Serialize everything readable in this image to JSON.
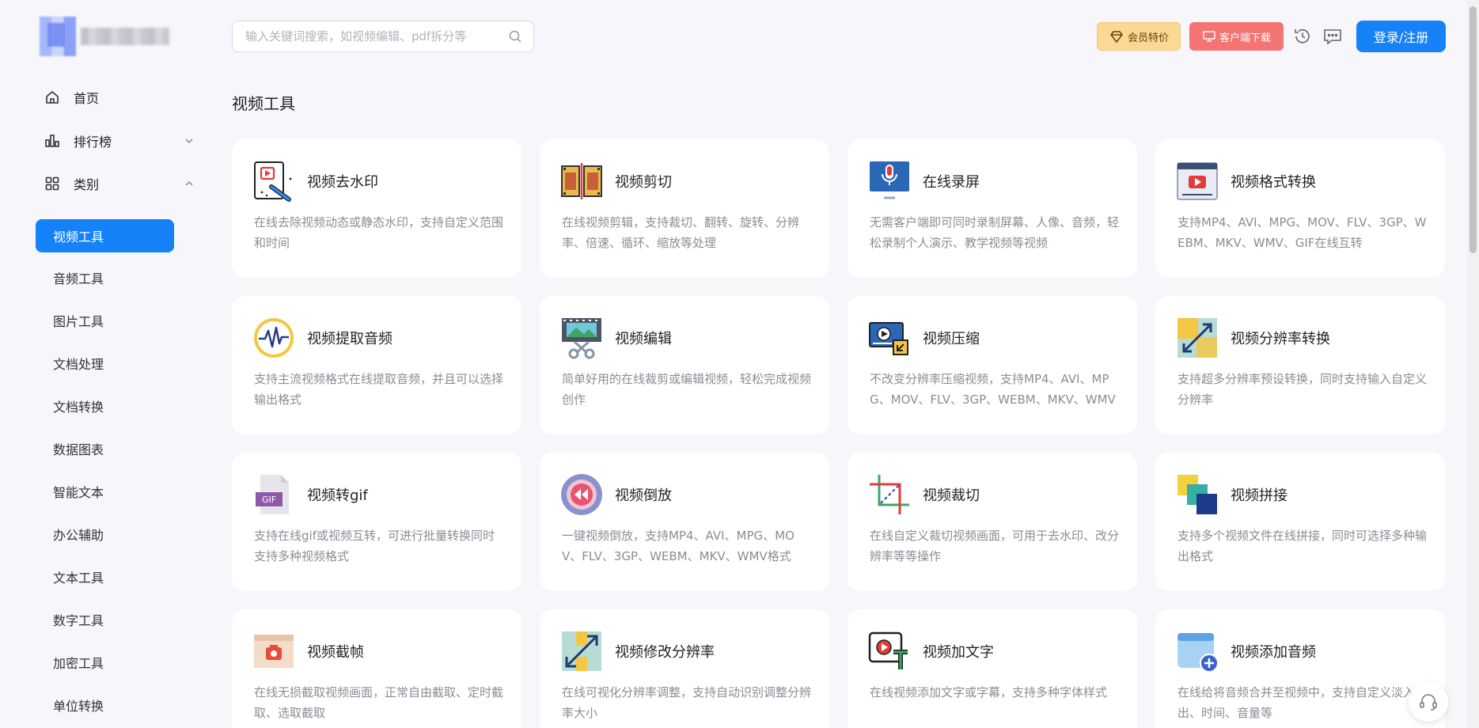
{
  "brand": {
    "logo_alt": "logo"
  },
  "sidebar": {
    "nav": [
      {
        "label": "首页",
        "icon": "home-icon"
      },
      {
        "label": "排行榜",
        "icon": "bar-chart-icon",
        "chevron": "chevron-down-icon"
      },
      {
        "label": "类别",
        "icon": "grid-icon",
        "chevron": "chevron-up-icon"
      }
    ],
    "categories": [
      {
        "label": "视频工具",
        "active": true
      },
      {
        "label": "音频工具"
      },
      {
        "label": "图片工具"
      },
      {
        "label": "文档处理"
      },
      {
        "label": "文档转换"
      },
      {
        "label": "数据图表"
      },
      {
        "label": "智能文本"
      },
      {
        "label": "办公辅助"
      },
      {
        "label": "文本工具"
      },
      {
        "label": "数字工具"
      },
      {
        "label": "加密工具"
      },
      {
        "label": "单位转换"
      }
    ]
  },
  "header": {
    "search_placeholder": "输入关键词搜索，如视频编辑、pdf拆分等",
    "vip_label": "会员特价",
    "client_label": "客户端下载",
    "login_label": "登录/注册"
  },
  "main": {
    "section_title": "视频工具",
    "cards": [
      {
        "title": "视频去水印",
        "desc": "在线去除视频动态或静态水印，支持自定义范围和时间",
        "icon": "watermark-remove-icon"
      },
      {
        "title": "视频剪切",
        "desc": "在线视频剪辑，支持裁切、翻转、旋转、分辨率、倍速、循环、缩放等处理",
        "icon": "film-cut-icon"
      },
      {
        "title": "在线录屏",
        "desc": "无需客户端即可同时录制屏幕、人像、音频，轻松录制个人演示、教学视频等视频",
        "icon": "screen-record-icon"
      },
      {
        "title": "视频格式转换",
        "desc": "支持MP4、AVI、MPG、MOV、FLV、3GP、WEBM、MKV、WMV、GIF在线互转",
        "icon": "video-format-icon"
      },
      {
        "title": "视频提取音频",
        "desc": "支持主流视频格式在线提取音频，并且可以选择输出格式",
        "icon": "audio-wave-icon"
      },
      {
        "title": "视频编辑",
        "desc": "简单好用的在线裁剪或编辑视频，轻松完成视频创作",
        "icon": "video-edit-icon"
      },
      {
        "title": "视频压缩",
        "desc": "不改变分辨率压缩视频，支持MP4、AVI、MPG、MOV、FLV、3GP、WEBM、MKV、WMV",
        "icon": "video-compress-icon"
      },
      {
        "title": "视频分辨率转换",
        "desc": "支持超多分辨率预设转换，同时支持输入自定义分辨率",
        "icon": "resolution-icon"
      },
      {
        "title": "视频转gif",
        "desc": "支持在线gif或视频互转，可进行批量转换同时支持多种视频格式",
        "icon": "gif-file-icon"
      },
      {
        "title": "视频倒放",
        "desc": "一键视频倒放，支持MP4、AVI、MPG、MOV、FLV、3GP、WEBM、MKV、WMV格式",
        "icon": "rewind-icon"
      },
      {
        "title": "视频裁切",
        "desc": "在线自定义裁切视频画面，可用于去水印、改分辨率等等操作",
        "icon": "crop-icon"
      },
      {
        "title": "视频拼接",
        "desc": "支持多个视频文件在线拼接，同时可选择多种输出格式",
        "icon": "merge-icon"
      },
      {
        "title": "视频截帧",
        "desc": "在线无损截取视频画面，正常自由截取、定时截取、选取截取",
        "icon": "frame-capture-icon"
      },
      {
        "title": "视频修改分辨率",
        "desc": "在线可视化分辨率调整，支持自动识别调整分辨率大小",
        "icon": "resize-icon"
      },
      {
        "title": "视频加文字",
        "desc": "在线视频添加文字或字幕，支持多种字体样式",
        "icon": "video-text-icon"
      },
      {
        "title": "视频添加音频",
        "desc": "在线给将音频合并至视频中，支持自定义淡入淡出、时间、音量等",
        "icon": "add-audio-icon"
      }
    ]
  },
  "colors": {
    "accent": "#1682f8",
    "vip_bg": "#fbd995",
    "client_bg": "#f47373",
    "page_bg": "#f6f6fb"
  }
}
